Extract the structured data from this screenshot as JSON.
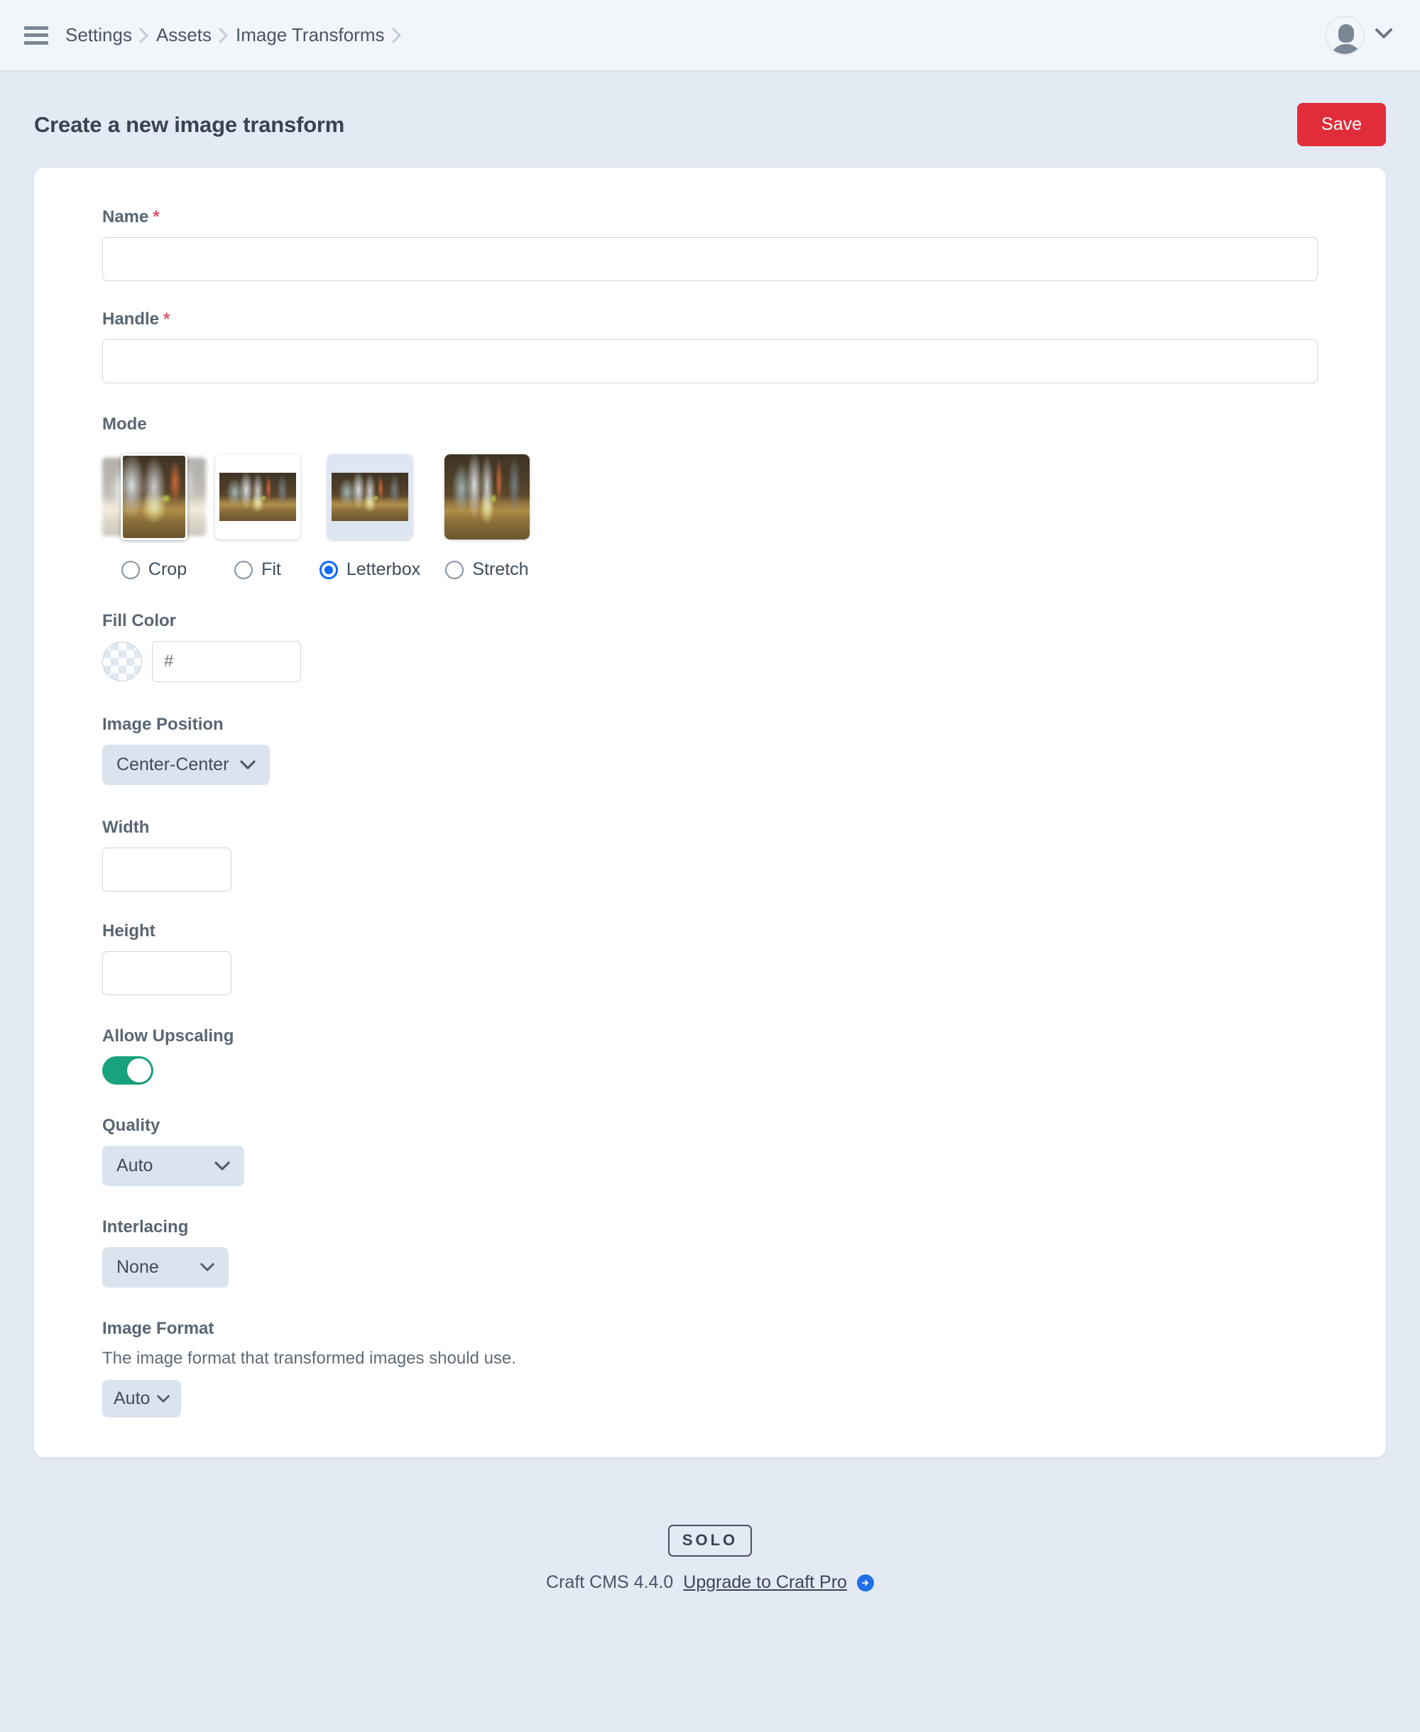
{
  "header": {
    "menu_icon": "hamburger-icon",
    "breadcrumbs": [
      {
        "label": "Settings"
      },
      {
        "label": "Assets"
      },
      {
        "label": "Image Transforms"
      }
    ],
    "account": {
      "avatar_icon": "user-avatar-icon",
      "chevron_icon": "chevron-down-icon"
    }
  },
  "page": {
    "title": "Create a new image transform",
    "save_label": "Save",
    "save_color": "#e12d39"
  },
  "form": {
    "name": {
      "label": "Name",
      "required_mark": "*",
      "value": "",
      "placeholder": ""
    },
    "handle": {
      "label": "Handle",
      "required_mark": "*",
      "value": "",
      "placeholder": ""
    },
    "mode": {
      "label": "Mode",
      "selected": "Letterbox",
      "options": [
        {
          "label": "Crop",
          "value": "crop",
          "checked": false
        },
        {
          "label": "Fit",
          "value": "fit",
          "checked": false
        },
        {
          "label": "Letterbox",
          "value": "letterbox",
          "checked": true
        },
        {
          "label": "Stretch",
          "value": "stretch",
          "checked": false
        }
      ]
    },
    "fill_color": {
      "label": "Fill Color",
      "swatch": "transparent-checkerboard",
      "value": "",
      "placeholder": "#"
    },
    "image_position": {
      "label": "Image Position",
      "value": "Center-Center"
    },
    "width": {
      "label": "Width",
      "value": "",
      "placeholder": ""
    },
    "height": {
      "label": "Height",
      "value": "",
      "placeholder": ""
    },
    "allow_upscaling": {
      "label": "Allow Upscaling",
      "enabled": true,
      "on_color": "#18a37e"
    },
    "quality": {
      "label": "Quality",
      "value": "Auto"
    },
    "interlacing": {
      "label": "Interlacing",
      "value": "None"
    },
    "image_format": {
      "label": "Image Format",
      "instructions": "The image format that transformed images should use.",
      "value": "Auto"
    }
  },
  "footer": {
    "edition_badge": "SOLO",
    "version": "Craft CMS 4.4.0",
    "upgrade_label": "Upgrade to Craft Pro",
    "upgrade_icon": "arrow-right-circle-icon",
    "link_color": "#1f6fe5"
  }
}
